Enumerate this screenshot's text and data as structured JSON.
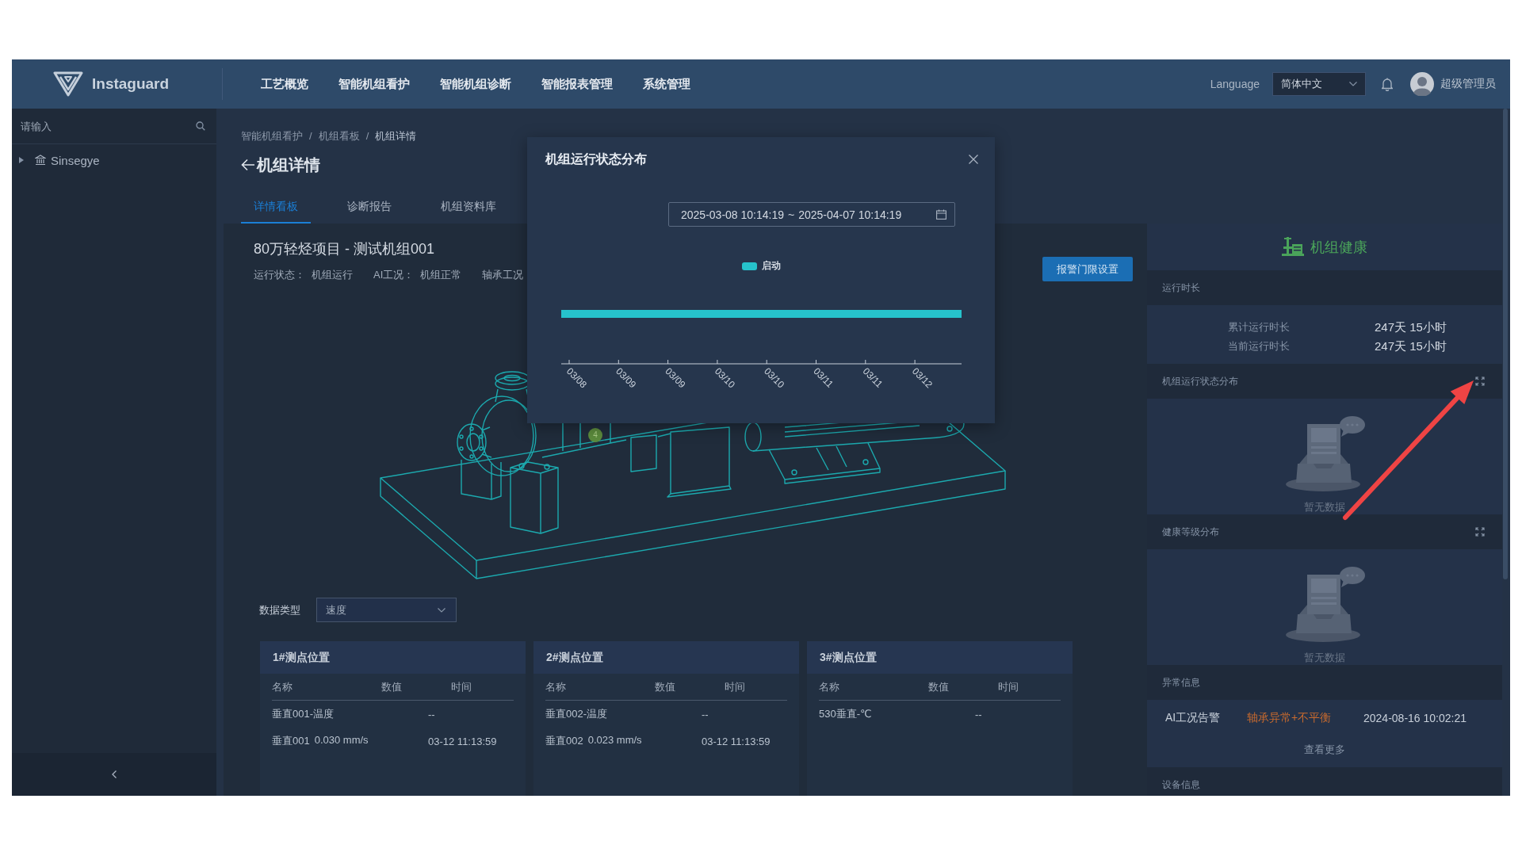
{
  "header": {
    "logo": "Instaguard",
    "nav": [
      "工艺概览",
      "智能机组看护",
      "智能机组诊断",
      "智能报表管理",
      "系统管理"
    ],
    "language": {
      "label": "Language",
      "value": "简体中文"
    },
    "user": {
      "name": "超级管理员"
    }
  },
  "sidebar": {
    "search": {
      "placeholder": "请输入"
    },
    "tree": [
      {
        "label": "Sinsegye",
        "expanded": false
      }
    ]
  },
  "breadcrumb": {
    "items": [
      "智能机组看护",
      "机组看板",
      "机组详情"
    ],
    "separator": "/"
  },
  "page_title": "机组详情",
  "tabs": [
    {
      "label": "详情看板",
      "selected": true
    },
    {
      "label": "诊断报告",
      "selected": false
    },
    {
      "label": "机组资料库",
      "selected": false
    }
  ],
  "unit": {
    "title": "80万轻烃项目 - 测试机组001",
    "status": [
      {
        "label": "运行状态：",
        "value": "机组运行"
      },
      {
        "label": "AI工况：",
        "value": "机组正常"
      },
      {
        "label": "轴承工况"
      }
    ],
    "alarm_button": "报警门限设置",
    "markers": [
      {
        "label": "4"
      }
    ]
  },
  "data_type": {
    "label": "数据类型",
    "value": "速度"
  },
  "measure_points": [
    {
      "title": "1#测点位置",
      "columns": [
        "名称",
        "数值",
        "时间"
      ],
      "rows": [
        {
          "name": "垂直001-温度",
          "time": "--"
        },
        {
          "name": "垂直001",
          "value": "0.030 mm/s",
          "time": "03-12 11:13:59"
        }
      ]
    },
    {
      "title": "2#测点位置",
      "columns": [
        "名称",
        "数值",
        "时间"
      ],
      "rows": [
        {
          "name": "垂直002-温度",
          "time": "--"
        },
        {
          "name": "垂直002",
          "value": "0.023 mm/s",
          "time": "03-12 11:13:59"
        }
      ]
    },
    {
      "title": "3#测点位置",
      "columns": [
        "名称",
        "数值",
        "时间"
      ],
      "rows": [
        {
          "name": "530垂直-℃",
          "time": "--"
        }
      ]
    }
  ],
  "health_panel": {
    "title": "机组健康",
    "sections": [
      {
        "title": "运行时长",
        "kind": "stats",
        "expandable": false,
        "rows": [
          {
            "label": "累计运行时长",
            "value": "247天 15小时"
          },
          {
            "label": "当前运行时长",
            "value": "247天 15小时"
          }
        ]
      },
      {
        "title": "机组运行状态分布",
        "kind": "empty",
        "expandable": true,
        "message": "暂无数据"
      },
      {
        "title": "健康等级分布",
        "kind": "empty",
        "expandable": true,
        "message": "暂无数据"
      },
      {
        "title": "异常信息",
        "kind": "alerts",
        "expandable": false,
        "alerts": [
          {
            "type": "AI工况告警",
            "detail": "轴承异常+不平衡",
            "time": "2024-08-16 10:02:21"
          }
        ],
        "more": "查看更多"
      },
      {
        "title": "设备信息",
        "kind": "info",
        "expandable": false
      }
    ]
  },
  "modal": {
    "title": "机组运行状态分布",
    "date_range": {
      "start": "2025-03-08 10:14:19",
      "separator": "~",
      "end": "2025-04-07 10:14:19"
    },
    "legend": [
      {
        "label": "启动",
        "color": "#26c3cc"
      }
    ],
    "x_labels": [
      "03/08",
      "03/09",
      "03/09",
      "03/10",
      "03/10",
      "03/11",
      "03/11",
      "03/12"
    ]
  }
}
